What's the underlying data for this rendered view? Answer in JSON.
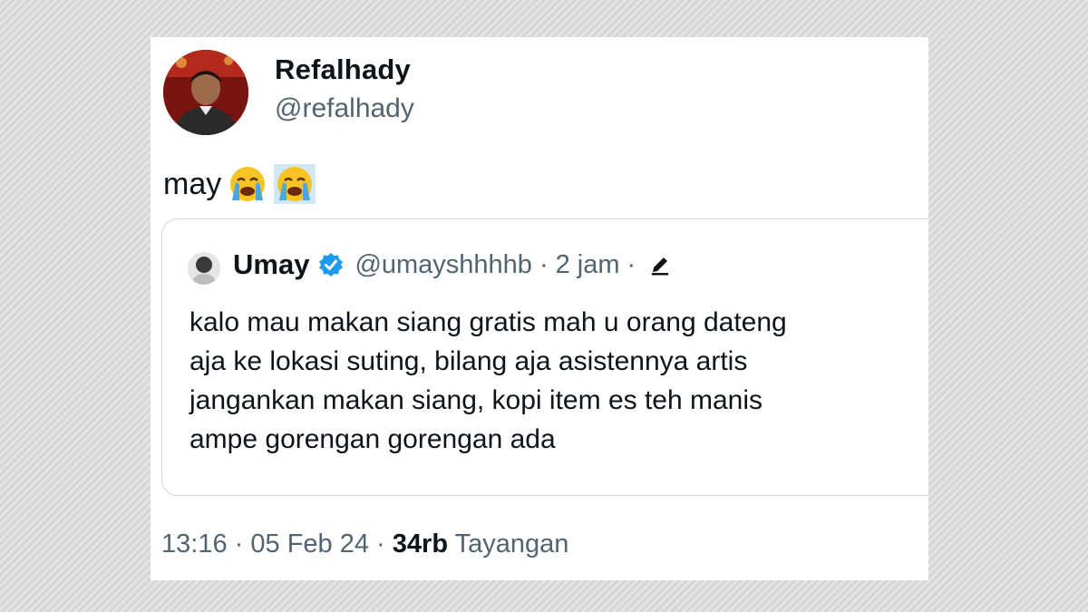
{
  "post": {
    "author": {
      "display_name": "Refalhady",
      "handle": "@refalhady",
      "avatar_icon": "profile-photo"
    },
    "text": "may",
    "emojis": [
      "loudly-crying-face-emoji",
      "loudly-crying-face-emoji"
    ],
    "quoted": {
      "display_name": "Umay",
      "verified_icon": "verified-badge-icon",
      "handle": "@umayshhhhb",
      "separator": "·",
      "time": "2 jam",
      "edited_icon": "pencil-icon",
      "text": "kalo mau makan siang gratis mah u orang dateng\naja ke lokasi suting, bilang aja asistennya artis\njangankan makan siang, kopi item es teh manis\nampe gorengan gorengan ada"
    },
    "meta": {
      "time": "13:16",
      "separator": "·",
      "date": "05 Feb 24",
      "views_count": "34rb",
      "views_label": "Tayangan"
    }
  },
  "colors": {
    "primary_text": "#0f1419",
    "secondary_text": "#536471",
    "border": "#cfd9de",
    "verified": "#1d9bf0"
  }
}
